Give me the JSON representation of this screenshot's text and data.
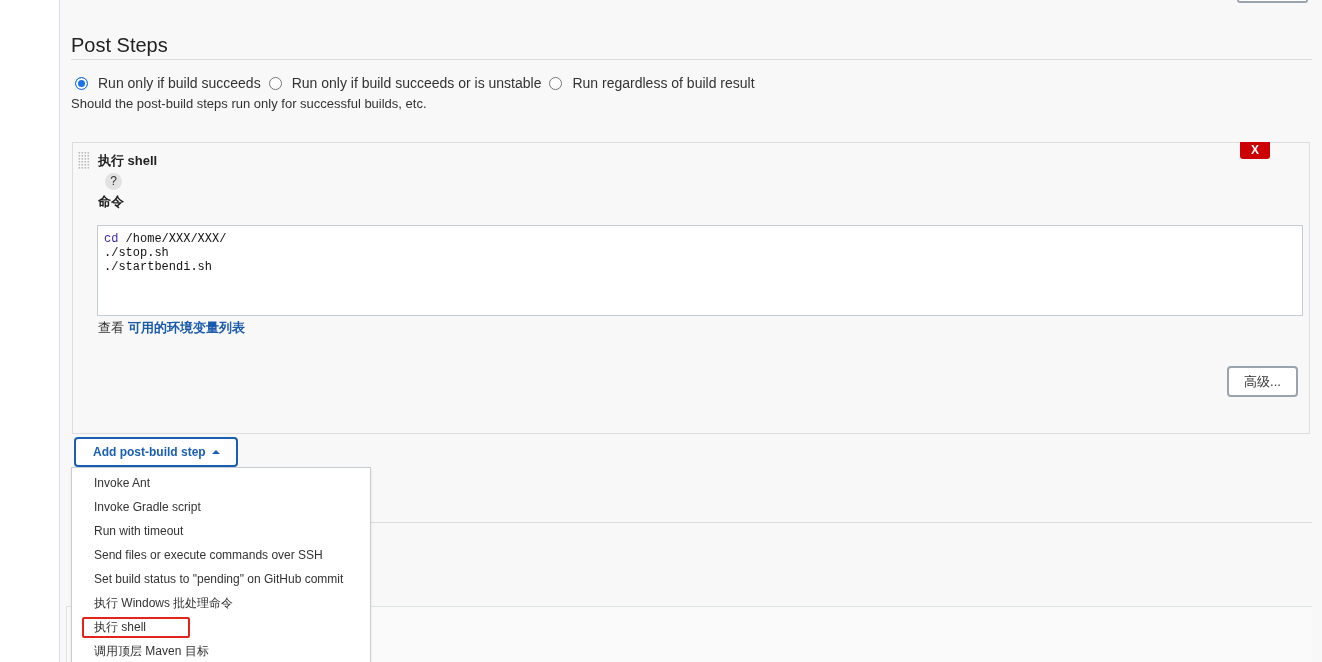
{
  "post_steps": {
    "heading": "Post Steps",
    "options": [
      {
        "label": "Run only if build succeeds",
        "selected": true
      },
      {
        "label": "Run only if build succeeds or is unstable",
        "selected": false
      },
      {
        "label": "Run regardless of build result",
        "selected": false
      }
    ],
    "description": "Should the post-build steps run only for successful builds, etc."
  },
  "shell_step": {
    "title": "执行 shell",
    "delete": "X",
    "help": "?",
    "command_label": "命令",
    "command_lines": [
      {
        "tokens": [
          {
            "text": "cd",
            "kind": "keyword"
          },
          {
            "text": "/home/XXX/XXX/",
            "kind": "plain"
          }
        ]
      },
      {
        "tokens": [
          {
            "text": "./stop.sh",
            "kind": "plain"
          }
        ]
      },
      {
        "tokens": [
          {
            "text": "./startbendi.sh",
            "kind": "plain"
          }
        ]
      }
    ],
    "env_vars": {
      "prefix": "查看",
      "link": "可用的环境变量列表"
    },
    "advanced_button": "高级..."
  },
  "add_step": {
    "label": "Add post-build step",
    "expanded": true,
    "items": [
      {
        "label": "Invoke Ant",
        "marked": false
      },
      {
        "label": "Invoke Gradle script",
        "marked": false
      },
      {
        "label": "Run with timeout",
        "marked": false
      },
      {
        "label": "Send files or execute commands over SSH",
        "marked": false
      },
      {
        "label": "Set build status to \"pending\" on GitHub commit",
        "marked": false
      },
      {
        "label": "执行 Windows 批处理命令",
        "marked": false
      },
      {
        "label": "执行 shell",
        "marked": true
      },
      {
        "label": "调用顶层 Maven 目标",
        "marked": false
      }
    ]
  }
}
